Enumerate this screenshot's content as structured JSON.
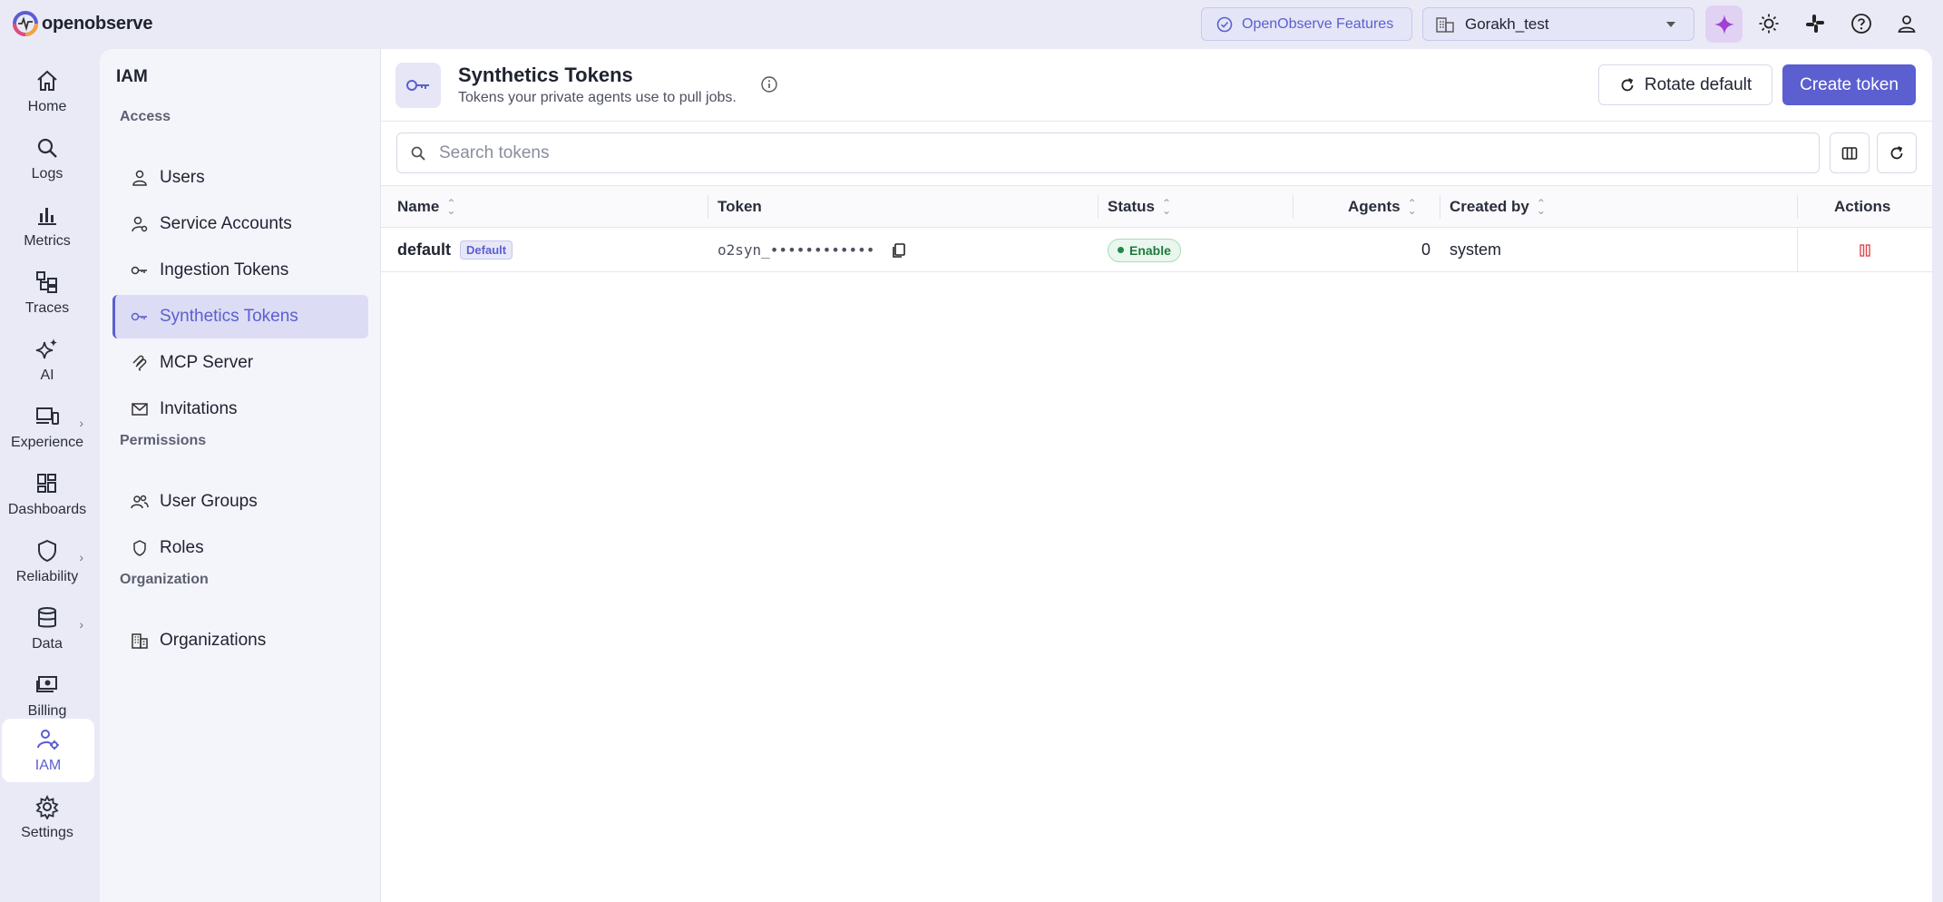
{
  "app": {
    "logo_text": "openobserve"
  },
  "topbar": {
    "features_label": "OpenObserve Features",
    "org_selected": "Gorakh_test"
  },
  "rail": {
    "items": [
      {
        "label": "Home",
        "icon": "home-icon"
      },
      {
        "label": "Logs",
        "icon": "search-icon"
      },
      {
        "label": "Metrics",
        "icon": "bar-chart-icon"
      },
      {
        "label": "Traces",
        "icon": "traces-icon"
      },
      {
        "label": "AI",
        "icon": "sparkle-icon"
      },
      {
        "label": "Experience",
        "icon": "devices-icon"
      },
      {
        "label": "Dashboards",
        "icon": "dashboard-icon"
      },
      {
        "label": "Reliability",
        "icon": "shield-icon"
      },
      {
        "label": "Data",
        "icon": "database-icon"
      },
      {
        "label": "Billing",
        "icon": "billing-icon"
      },
      {
        "label": "IAM",
        "icon": "iam-icon"
      },
      {
        "label": "Settings",
        "icon": "gear-icon"
      }
    ],
    "active": "IAM"
  },
  "subnav": {
    "title": "IAM",
    "sections": {
      "access": "Access",
      "permissions": "Permissions",
      "organization": "Organization"
    },
    "items": [
      {
        "label": "Users"
      },
      {
        "label": "Service Accounts"
      },
      {
        "label": "Ingestion Tokens"
      },
      {
        "label": "Synthetics Tokens"
      },
      {
        "label": "MCP Server"
      },
      {
        "label": "Invitations"
      },
      {
        "label": "User Groups"
      },
      {
        "label": "Roles"
      },
      {
        "label": "Organizations"
      }
    ],
    "active": "Synthetics Tokens"
  },
  "page": {
    "title": "Synthetics Tokens",
    "subtitle": "Tokens your private agents use to pull jobs.",
    "rotate_label": "Rotate default",
    "create_label": "Create token",
    "search_placeholder": "Search tokens"
  },
  "table": {
    "columns": [
      "Name",
      "Token",
      "Status",
      "Agents",
      "Created by",
      "Actions"
    ],
    "rows": [
      {
        "name": "default",
        "badge": "Default",
        "token": "o2syn_••••••••••••",
        "status": "Enable",
        "agents": "0",
        "created_by": "system"
      }
    ]
  },
  "colors": {
    "accent": "#5b5fd0",
    "status_enabled": "#1f7a3e",
    "delete": "#e0474c"
  }
}
